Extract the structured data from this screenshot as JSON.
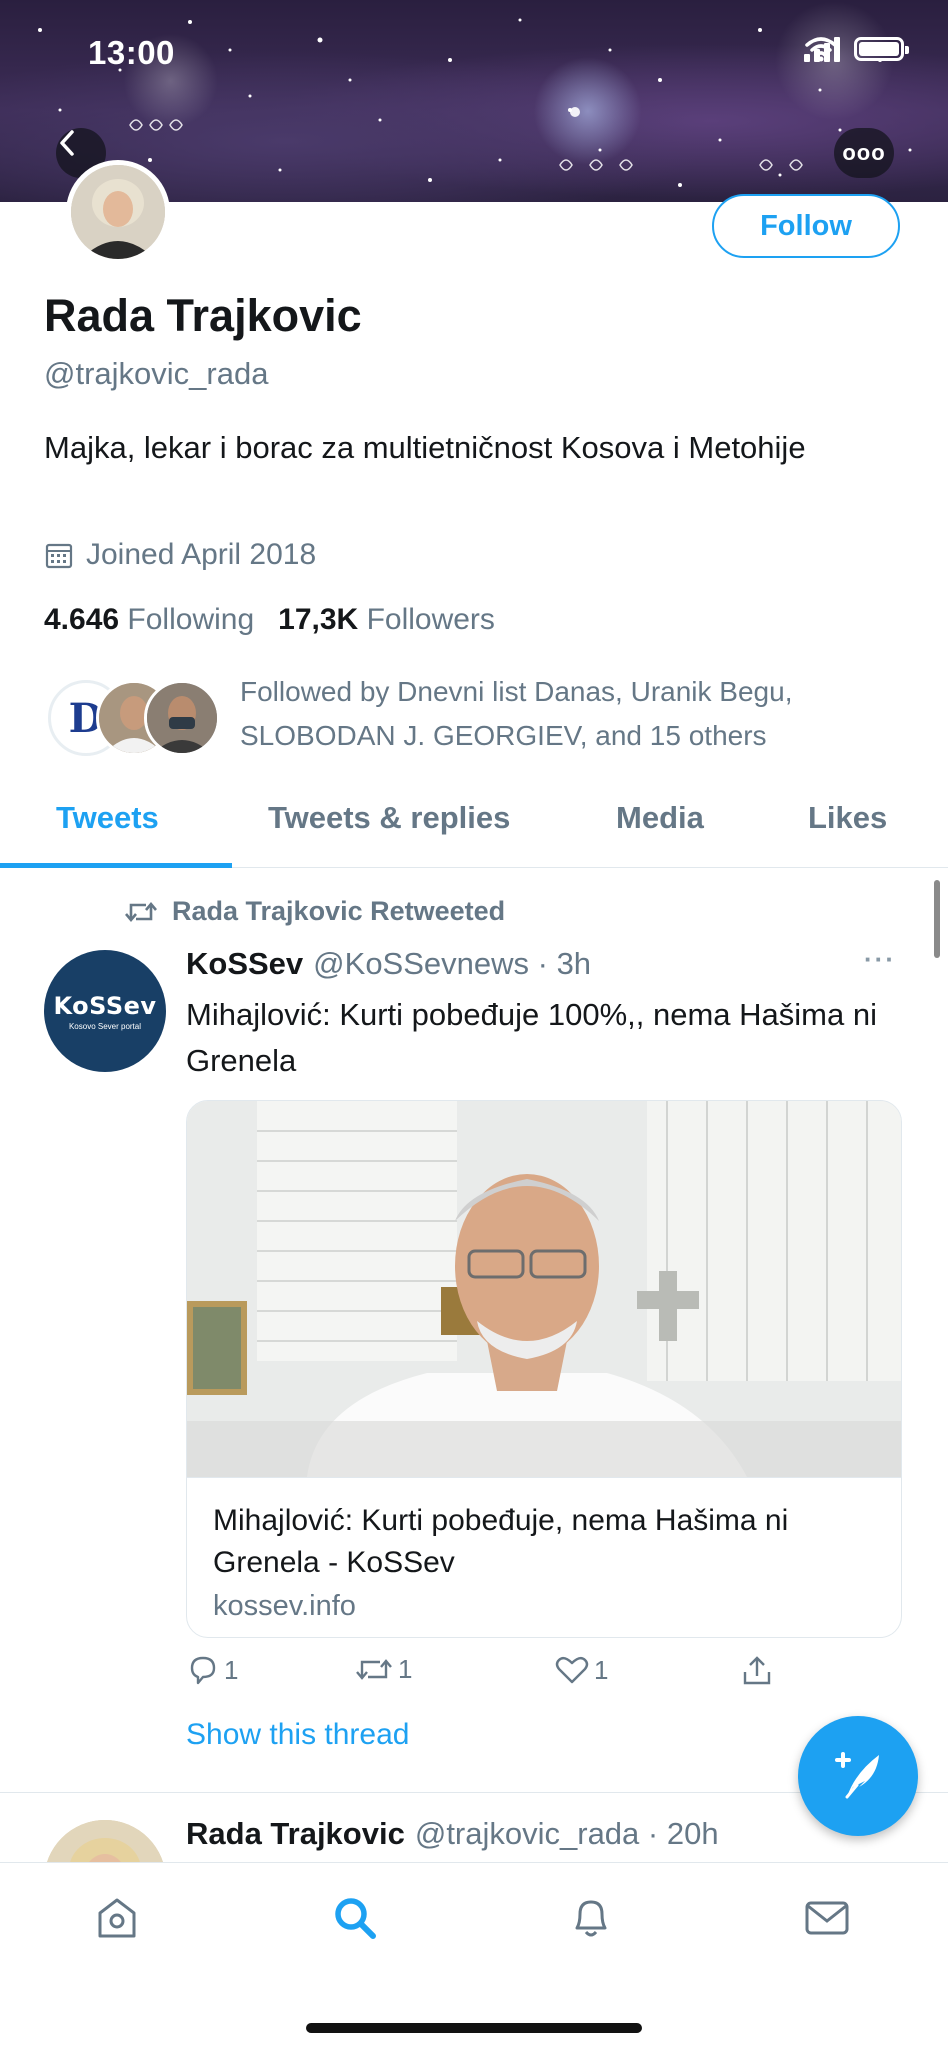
{
  "status_bar": {
    "time": "13:00"
  },
  "colors": {
    "accent": "#1da1f2",
    "text_primary": "#14171a",
    "text_secondary": "#657786",
    "banner_bg": "#2a1f3f"
  },
  "header": {
    "back_icon": "chevron-left-icon",
    "more_label": "ooo"
  },
  "profile": {
    "follow_label": "Follow",
    "name": "Rada Trajkovic",
    "handle": "@trajkovic_rada",
    "bio": "Majka, lekar i borac za multietničnost Kosova i Metohije",
    "joined": "Joined April 2018",
    "following_count": "4.646",
    "following_label": "Following",
    "followers_count": "17,3K",
    "followers_label": "Followers",
    "followed_by": "Followed by Dnevni list Danas, Uranik Begu, SLOBODAN J. GEORGIEV, and 15 others",
    "followed_logo_letter": "D"
  },
  "tabs": [
    {
      "label": "Tweets",
      "active": true
    },
    {
      "label": "Tweets & replies",
      "active": false
    },
    {
      "label": "Media",
      "active": false
    },
    {
      "label": "Likes",
      "active": false
    }
  ],
  "tweets": [
    {
      "retweet_line": "Rada Trajkovic Retweeted",
      "avatar_logo": "KoSSev",
      "avatar_logo_sub": "Kosovo Sever portal",
      "author_name": "KoSSev",
      "author_meta": "@KoSSevnews · 3h",
      "more_label": "···",
      "text": "Mihajlović: Kurti pobeđuje 100%,, nema Hašima ni Grenela",
      "card": {
        "title": "Mihajlović: Kurti pobeđuje, nema Hašima ni Grenela - KoSSev",
        "domain": "kossev.info"
      },
      "reply_count": "1",
      "retweet_count": "1",
      "like_count": "1",
      "show_thread": "Show this thread"
    },
    {
      "author_name": "Rada Trajkovic",
      "author_meta": "@trajkovic_rada · 20h"
    }
  ],
  "nav": [
    {
      "icon": "home-icon",
      "active": false
    },
    {
      "icon": "search-icon",
      "active": true
    },
    {
      "icon": "bell-icon",
      "active": false
    },
    {
      "icon": "mail-icon",
      "active": false
    }
  ]
}
